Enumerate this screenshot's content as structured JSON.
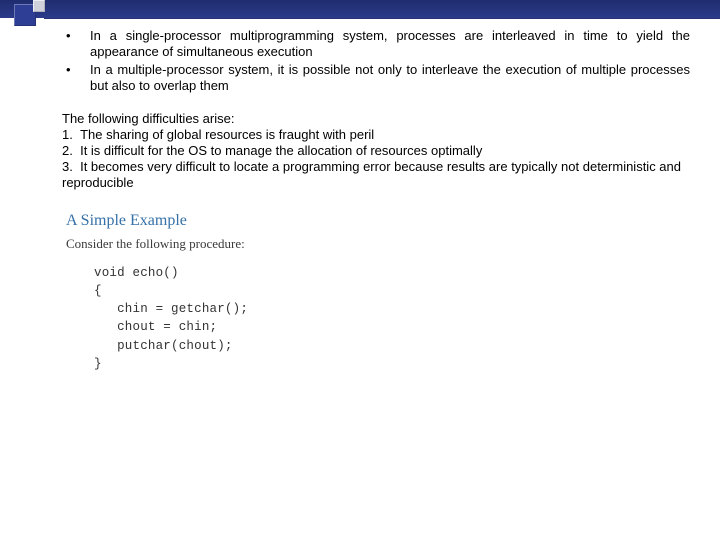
{
  "bullets": [
    "In a single-processor multiprogramming system, processes are interleaved in time to yield the appearance of simultaneous execution",
    "In a multiple-processor system, it is possible not only to interleave the execution of multiple processes but also to overlap them"
  ],
  "difficulties_intro": "The following difficulties arise:",
  "difficulties": [
    "The sharing of global resources is fraught with peril",
    "It is difficult for the OS to manage the allocation of resources optimally",
    "It becomes very difficult to locate a programming error because results are typically not deterministic and reproducible"
  ],
  "example_heading": "A Simple Example",
  "example_sub": "Consider the following procedure:",
  "code_lines": [
    "void echo()",
    "{",
    "   chin = getchar();",
    "   chout = chin;",
    "   putchar(chout);",
    "}"
  ]
}
